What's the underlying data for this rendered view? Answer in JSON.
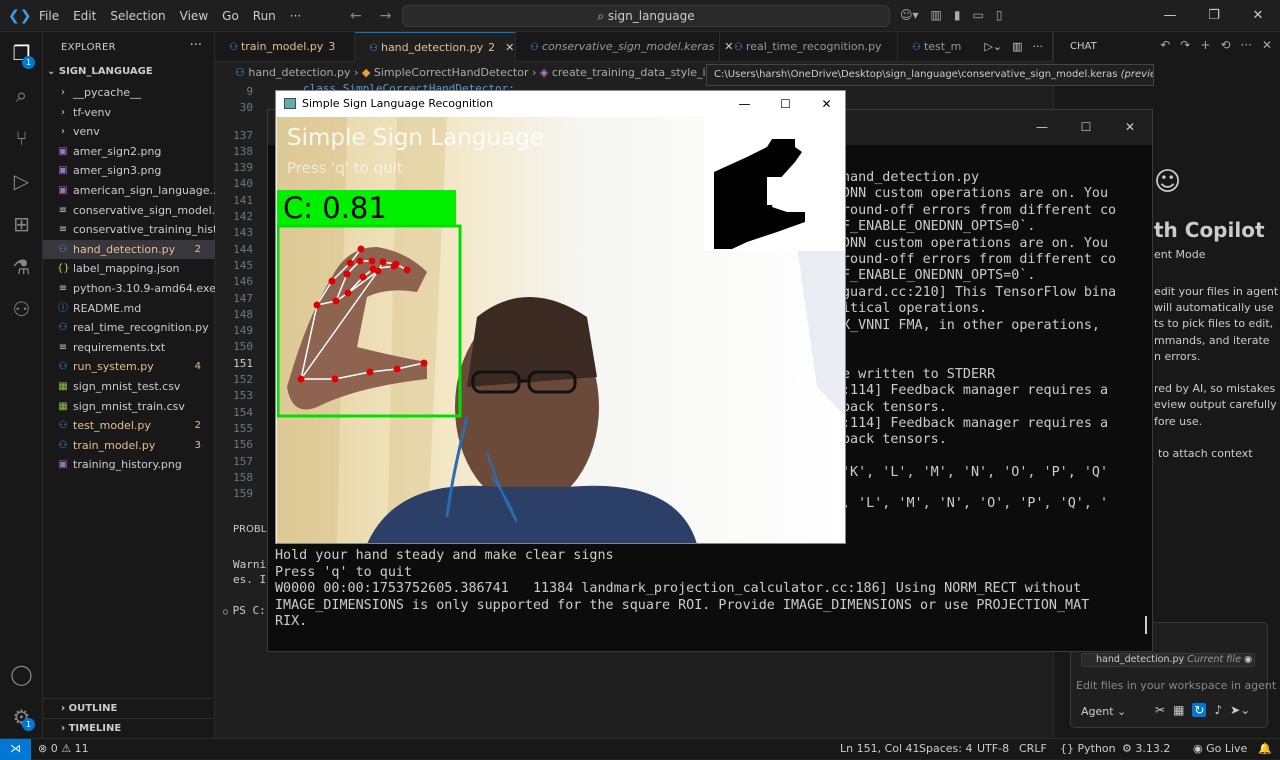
{
  "titlebar": {
    "menu": [
      "File",
      "Edit",
      "Selection",
      "View",
      "Go",
      "Run",
      "···"
    ],
    "search": "sign_language"
  },
  "activity": {
    "explorer_badge": "1",
    "settings_badge": "1"
  },
  "explorer": {
    "header": "EXPLORER",
    "root": "SIGN_LANGUAGE",
    "items": [
      {
        "label": "__pycache__",
        "icon": "folder-chevron-icon",
        "count": "",
        "color": "#cccccc"
      },
      {
        "label": "tf-venv",
        "icon": "folder-chevron-icon",
        "count": "",
        "color": "#cccccc"
      },
      {
        "label": "venv",
        "icon": "folder-chevron-icon",
        "count": "",
        "color": "#cccccc"
      },
      {
        "label": "amer_sign2.png",
        "icon": "image-file-icon",
        "count": "",
        "color": "#cccccc"
      },
      {
        "label": "amer_sign3.png",
        "icon": "image-file-icon",
        "count": "",
        "color": "#cccccc"
      },
      {
        "label": "american_sign_language....",
        "icon": "image-file-icon",
        "count": "",
        "color": "#cccccc"
      },
      {
        "label": "conservative_sign_model....",
        "icon": "generic-file-icon",
        "count": "",
        "color": "#cccccc"
      },
      {
        "label": "conservative_training_hist...",
        "icon": "generic-file-icon",
        "count": "",
        "color": "#cccccc"
      },
      {
        "label": "hand_detection.py",
        "icon": "python-file-icon",
        "count": "2",
        "color": "#e2c08d"
      },
      {
        "label": "label_mapping.json",
        "icon": "json-file-icon",
        "count": "",
        "color": "#cccccc"
      },
      {
        "label": "python-3.10.9-amd64.exe",
        "icon": "generic-file-icon",
        "count": "",
        "color": "#cccccc"
      },
      {
        "label": "README.md",
        "icon": "info-file-icon",
        "count": "",
        "color": "#cccccc"
      },
      {
        "label": "real_time_recognition.py",
        "icon": "python-file-icon",
        "count": "",
        "color": "#cccccc"
      },
      {
        "label": "requirements.txt",
        "icon": "text-file-icon",
        "count": "",
        "color": "#cccccc"
      },
      {
        "label": "run_system.py",
        "icon": "python-file-icon",
        "count": "4",
        "color": "#e2c08d"
      },
      {
        "label": "sign_mnist_test.csv",
        "icon": "csv-file-icon",
        "count": "",
        "color": "#cccccc"
      },
      {
        "label": "sign_mnist_train.csv",
        "icon": "csv-file-icon",
        "count": "",
        "color": "#cccccc"
      },
      {
        "label": "test_model.py",
        "icon": "python-file-icon",
        "count": "2",
        "color": "#e2c08d"
      },
      {
        "label": "train_model.py",
        "icon": "python-file-icon",
        "count": "3",
        "color": "#e2c08d"
      },
      {
        "label": "training_history.png",
        "icon": "image-file-icon",
        "count": "",
        "color": "#cccccc"
      }
    ],
    "outline": "OUTLINE",
    "timeline": "TIMELINE"
  },
  "tabs": [
    {
      "label": "train_model.py",
      "count": "3",
      "italic": false
    },
    {
      "label": "hand_detection.py",
      "count": "2",
      "italic": false
    },
    {
      "label": "conservative_sign_model.keras",
      "count": "",
      "italic": true
    },
    {
      "label": "real_time_recognition.py",
      "count": "",
      "italic": false
    },
    {
      "label": "test_m",
      "count": "",
      "italic": false
    }
  ],
  "breadcrumb": {
    "file": "hand_detection.py",
    "class": "SimpleCorrectHandDetector",
    "method": "create_training_data_style_imag"
  },
  "tooltip": {
    "path": "C:\\Users\\harsh\\OneDrive\\Desktop\\sign_language\\conservative_sign_model.keras",
    "suffix": "(preview"
  },
  "code_line_top": "class SimpleCorrectHandDetector:",
  "line_numbers": [
    "9",
    "30",
    "137",
    "138",
    "139",
    "140",
    "141",
    "142",
    "143",
    "144",
    "145",
    "146",
    "147",
    "148",
    "149",
    "150",
    "151",
    "152",
    "153",
    "154",
    "155",
    "156",
    "157",
    "158",
    "159"
  ],
  "current_line": "151",
  "panel": {
    "header": "PROBLE",
    "lines": [
      "Warni",
      "es. I",
      "PS C:"
    ]
  },
  "cmd": {
    "right_lines": [
      "hand_detection.py",
      "DNN custom operations are on. You",
      "round-off errors from different co",
      "F_ENABLE_ONEDNN_OPTS=0`.",
      "DNN custom operations are on. You",
      "round-off errors from different co",
      "F_ENABLE_ONEDNN_OPTS=0`.",
      "guard.cc:210] This TensorFlow bina",
      "itical operations.",
      "X_VNNI FMA, in other operations,",
      "",
      "",
      "e written to STDERR",
      ":114] Feedback manager requires a",
      "back tensors.",
      ":114] Feedback manager requires a",
      "back tensors.",
      "",
      "'K', 'L', 'M', 'N', 'O', 'P', 'Q'",
      "",
      "",
      ", 'L', 'M', 'N', 'O', 'P', 'Q', '"
    ],
    "bottom_lines": [
      "Hold your hand steady and make clear signs",
      "Press 'q' to quit",
      "W0000 00:00:1753752605.386741   11384 landmark_projection_calculator.cc:186] Using NORM_RECT without",
      "IMAGE_DIMENSIONS is only supported for the square ROI. Provide IMAGE_DIMENSIONS or use PROJECTION_MAT",
      "RIX."
    ]
  },
  "opencv": {
    "title": "Simple Sign Language Recognition",
    "overlay_title": "Simple Sign Language",
    "overlay_sub": "Press 'q' to quit",
    "confidence": "C: 0.81"
  },
  "chat": {
    "header": "CHAT",
    "title": "th Copilot",
    "mode": "ent Mode",
    "lines": [
      "edit your files in agent",
      "will automatically use",
      "ts to pick files to edit,",
      "mmands, and iterate",
      "n errors.",
      "",
      "red by AI, so mistakes",
      "eview output carefully",
      "fore use.",
      "",
      "to attach context"
    ],
    "current_file": "hand_detection.py",
    "current_file_tag": "Current file",
    "placeholder": "Edit files in your workspace in agent",
    "agent_label": "Agent"
  },
  "status": {
    "problems": "0",
    "warnings": "11",
    "position": "Ln 151, Col 41",
    "spaces": "Spaces: 4",
    "encoding": "UTF-8",
    "eol": "CRLF",
    "language": "Python",
    "version": "3.13.2",
    "golive": "Go Live"
  }
}
